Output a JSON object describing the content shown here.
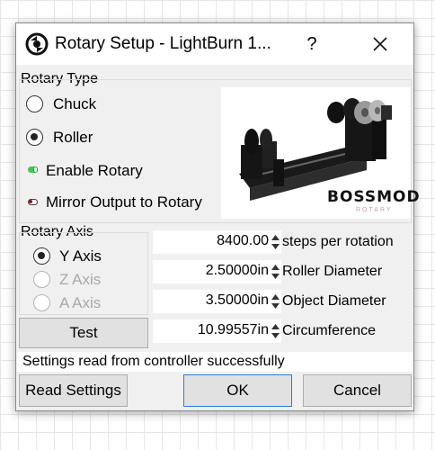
{
  "window": {
    "title": "Rotary Setup - LightBurn 1...",
    "help_label": "?",
    "close_icon": "close-icon",
    "app_icon": "lightburn-logo-icon"
  },
  "rotary_type": {
    "label": "Rotary Type",
    "options": [
      {
        "label": "Chuck",
        "checked": false
      },
      {
        "label": "Roller",
        "checked": true
      }
    ],
    "enable_rotary": {
      "label": "Enable Rotary",
      "on": true
    },
    "mirror_output": {
      "label": "Mirror Output to Rotary",
      "on": false
    },
    "photo": {
      "brand": "BOSSMOD",
      "subtitle": "ROTARY"
    }
  },
  "rotary_axis": {
    "label": "Rotary Axis",
    "options": [
      {
        "label": "Y Axis",
        "checked": true,
        "enabled": true
      },
      {
        "label": "Z Axis",
        "checked": false,
        "enabled": false
      },
      {
        "label": "A Axis",
        "checked": false,
        "enabled": false
      }
    ],
    "test_label": "Test"
  },
  "fields": [
    {
      "value": "8400.00",
      "caption": "steps per rotation"
    },
    {
      "value": "2.50000in",
      "caption": "Roller Diameter"
    },
    {
      "value": "3.50000in",
      "caption": "Object Diameter"
    },
    {
      "value": "10.99557in",
      "caption": "Circumference"
    }
  ],
  "status": "Settings read from controller successfully",
  "buttons": {
    "read_settings": "Read Settings",
    "ok": "OK",
    "cancel": "Cancel"
  },
  "colors": {
    "toggle_on": "#3cc94e",
    "toggle_off_knob": "#7a1a1a",
    "ok_border": "#2b7fd4"
  }
}
